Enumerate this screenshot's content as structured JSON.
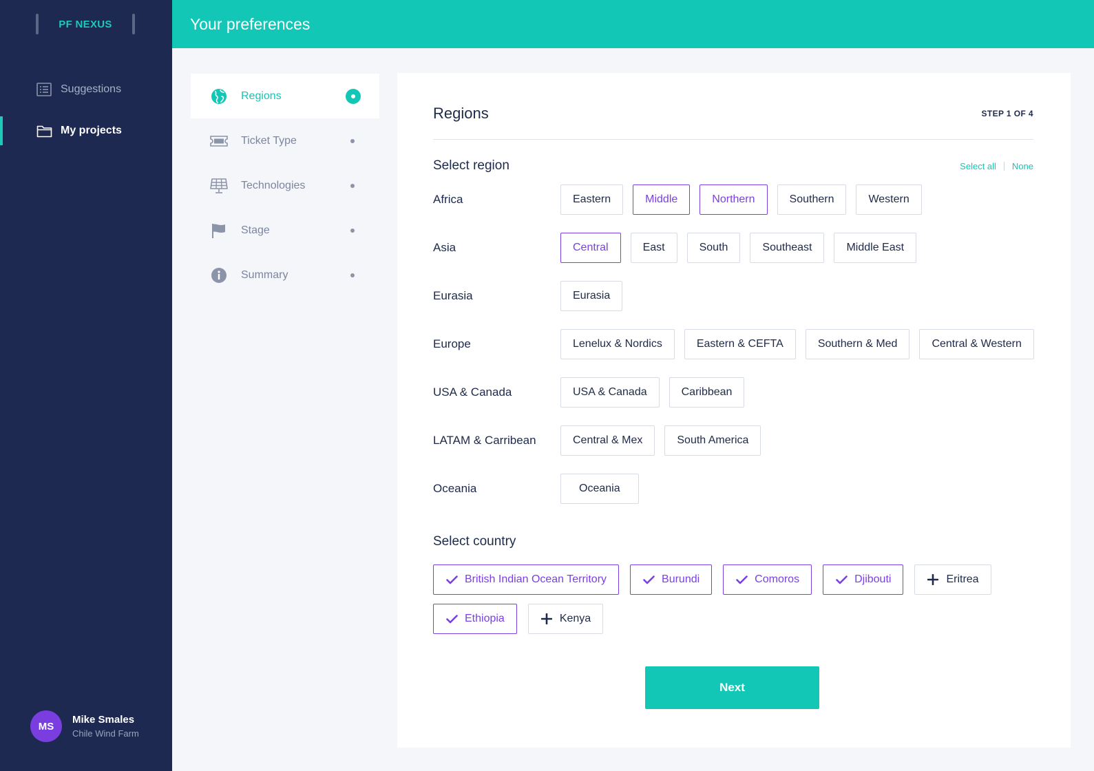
{
  "app": {
    "brand": "PF NEXUS"
  },
  "sidebar": {
    "items": [
      {
        "label": "Suggestions",
        "icon": "list-icon",
        "active": false
      },
      {
        "label": "My projects",
        "icon": "folder-icon",
        "active": true
      }
    ],
    "user": {
      "initials": "MS",
      "name": "Mike Smales",
      "project": "Chile Wind Farm"
    }
  },
  "header": {
    "title": "Your preferences"
  },
  "steps": [
    {
      "label": "Regions",
      "icon": "globe-icon",
      "active": true
    },
    {
      "label": "Ticket Type",
      "icon": "ticket-icon",
      "active": false
    },
    {
      "label": "Technologies",
      "icon": "solar-panel-icon",
      "active": false
    },
    {
      "label": "Stage",
      "icon": "flag-icon",
      "active": false
    },
    {
      "label": "Summary",
      "icon": "info-icon",
      "active": false
    }
  ],
  "main": {
    "title": "Regions",
    "step_indicator": "STEP 1 OF 4",
    "select_region_title": "Select region",
    "select_all": "Select all",
    "select_none": "None",
    "regions": [
      {
        "name": "Africa",
        "options": [
          {
            "label": "Eastern",
            "selected": false
          },
          {
            "label": "Middle",
            "selected": true
          },
          {
            "label": "Northern",
            "selected": true
          },
          {
            "label": "Southern",
            "selected": false
          },
          {
            "label": "Western",
            "selected": false
          }
        ]
      },
      {
        "name": "Asia",
        "options": [
          {
            "label": "Central",
            "selected": true
          },
          {
            "label": "East",
            "selected": false
          },
          {
            "label": "South",
            "selected": false
          },
          {
            "label": "Southeast",
            "selected": false
          },
          {
            "label": "Middle East",
            "selected": false
          }
        ]
      },
      {
        "name": "Eurasia",
        "options": [
          {
            "label": "Eurasia",
            "selected": false
          }
        ]
      },
      {
        "name": "Europe",
        "options": [
          {
            "label": "Lenelux & Nordics",
            "selected": false
          },
          {
            "label": "Eastern & CEFTA",
            "selected": false
          },
          {
            "label": "Southern & Med",
            "selected": false
          },
          {
            "label": "Central & Western",
            "selected": false
          }
        ]
      },
      {
        "name": "USA & Canada",
        "options": [
          {
            "label": "USA & Canada",
            "selected": false
          },
          {
            "label": "Caribbean",
            "selected": false
          }
        ]
      },
      {
        "name": "LATAM & Carribean",
        "options": [
          {
            "label": "Central & Mex",
            "selected": false
          },
          {
            "label": "South America",
            "selected": false
          }
        ]
      },
      {
        "name": "Oceania",
        "options": [
          {
            "label": "Oceania",
            "selected": false
          }
        ]
      }
    ],
    "select_country_title": "Select country",
    "countries": [
      {
        "label": "British Indian Ocean Territory",
        "selected": true
      },
      {
        "label": "Burundi",
        "selected": true
      },
      {
        "label": "Comoros",
        "selected": true
      },
      {
        "label": "Djibouti",
        "selected": true
      },
      {
        "label": "Eritrea",
        "selected": false
      },
      {
        "label": "Ethiopia",
        "selected": true
      },
      {
        "label": "Kenya",
        "selected": false
      }
    ],
    "next_label": "Next"
  },
  "colors": {
    "accent": "#12c7b6",
    "selected": "#7b3fe4",
    "sidebar": "#1d2951",
    "avatar": "#7a3ee0"
  }
}
